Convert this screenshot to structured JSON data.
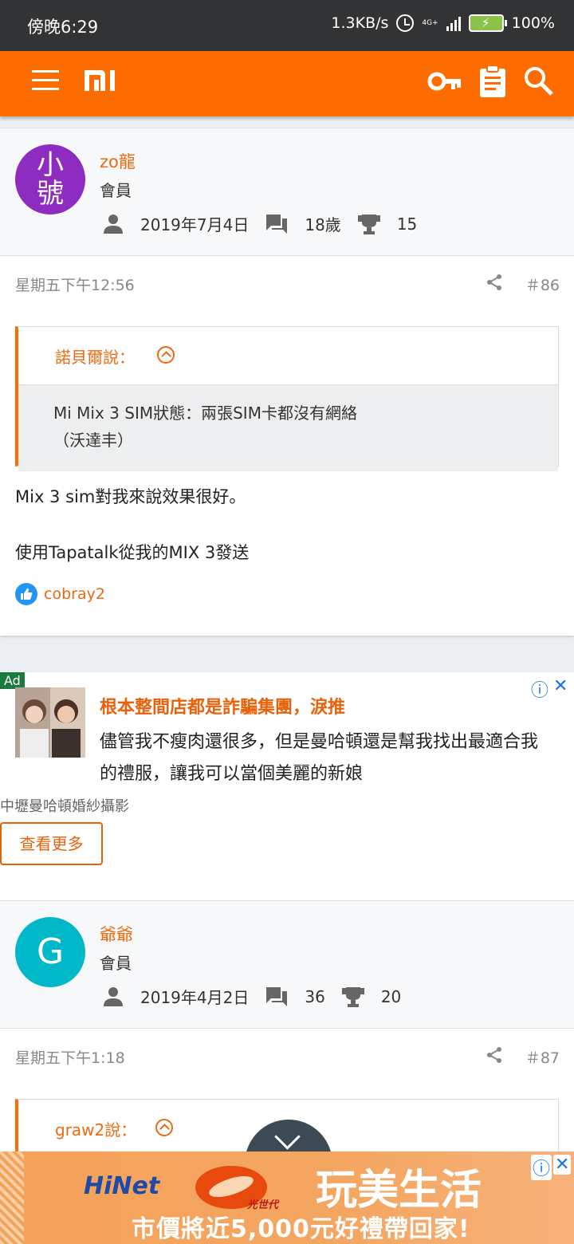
{
  "status_bar": {
    "time": "傍晚6:29",
    "net_speed": "1.3KB/s",
    "network": "4G+",
    "battery": "100%"
  },
  "header": {
    "logo": "mi-logo",
    "icons": [
      "menu-icon",
      "key-icon",
      "clipboard-icon",
      "search-icon"
    ],
    "brand_color": "#ff6d00"
  },
  "posts": [
    {
      "author": "zo龍",
      "avatar_text": "小號",
      "avatar_color": "#8e2bc0",
      "role": "會員",
      "joined": "2019年7月4日",
      "messages": "18歲",
      "trophies": "15",
      "time": "星期五下午12:56",
      "number": "＃86",
      "quote_author": "諾貝爾說：",
      "quote_text_line1": "Mi Mix 3 SIM狀態：兩張SIM卡都沒有網絡",
      "quote_text_line2": "（沃達丰）",
      "body_line1": "Mix 3 sim對我來說效果很好。",
      "body_line2": "使用Tapatalk從我的MIX 3發送",
      "liked_by": "cobray2"
    },
    {
      "author": "爺爺",
      "avatar_text": "G",
      "avatar_color": "#00b8c8",
      "role": "會員",
      "joined": "2019年4月2日",
      "messages": "36",
      "trophies": "20",
      "time": "星期五下午1:18",
      "number": "＃87",
      "quote_author": "graw2說："
    }
  ],
  "ad": {
    "tag": "Ad",
    "title": "根本整間店都是詐騙集團，淚推",
    "desc": "儘管我不瘦肉還很多，但是曼哈頓還是幫我找出最適合我的禮服，讓我可以當個美麗的新娘",
    "advertiser": "中壢曼哈頓婚紗攝影",
    "cta": "查看更多"
  },
  "banner": {
    "brand": "HiNet",
    "sub_brand": "光世代",
    "headline": "玩美生活",
    "subline": "市價將近5,000元好禮帶回家!"
  }
}
